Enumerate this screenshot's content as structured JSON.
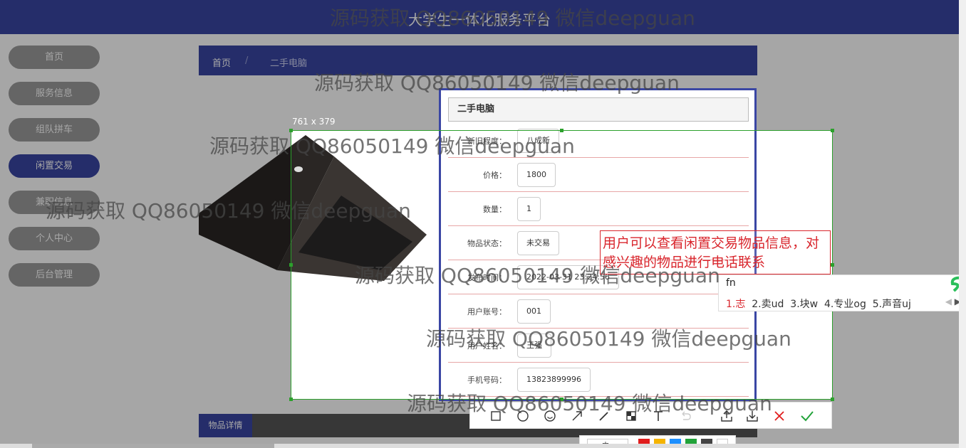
{
  "header": {
    "title": "大学生一体化服务平台"
  },
  "sidebar": {
    "items": [
      {
        "label": "首页"
      },
      {
        "label": "服务信息"
      },
      {
        "label": "组队拼车"
      },
      {
        "label": "闲置交易"
      },
      {
        "label": "兼职信息"
      },
      {
        "label": "个人中心"
      },
      {
        "label": "后台管理"
      }
    ]
  },
  "breadcrumb": {
    "home": "首页",
    "sep": "/",
    "current": "二手电脑"
  },
  "detail": {
    "title": "二手电脑",
    "rows": [
      {
        "label": "新旧程度：",
        "value": "八成新"
      },
      {
        "label": "价格：",
        "value": "1800"
      },
      {
        "label": "数量：",
        "value": "1"
      },
      {
        "label": "物品状态：",
        "value": "未交易"
      },
      {
        "label": "发布时间：",
        "value": "2022-03-31 23:24:56"
      },
      {
        "label": "用户账号：",
        "value": "001"
      },
      {
        "label": "用户姓名：",
        "value": "王强"
      },
      {
        "label": "手机号码：",
        "value": "13823899996"
      }
    ]
  },
  "tabs": {
    "details": "物品详情"
  },
  "screenshot_tool": {
    "size_label": "761 x 379",
    "annotation": "用户可以查看闲置交易物品信息，对感兴趣的物品进行电话联系",
    "font_select": "中",
    "colors": [
      "#e11d1d",
      "#f5b400",
      "#1e90ff",
      "#22a33a",
      "#444444",
      "#ffffff"
    ]
  },
  "ime": {
    "input": "fn",
    "candidates": [
      "1.志",
      "2.卖ud",
      "3.块w",
      "4.专业og",
      "5.声音uj"
    ]
  },
  "watermark": "源码获取 QQ86050149 微信deepguan"
}
